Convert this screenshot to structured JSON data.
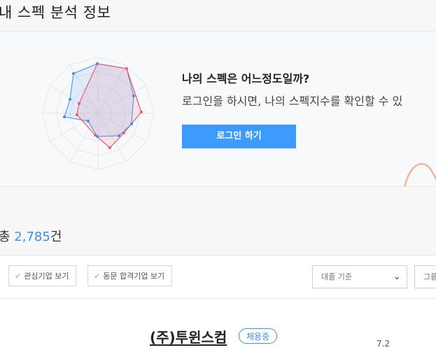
{
  "header": {
    "title": "내 스펙 분석 정보"
  },
  "promo": {
    "heading": "나의 스펙은 어느정도일까?",
    "desc": "로그인을 하시면, 나의 스펙지수를 확인할 수 있",
    "login_button": "로그인 하기",
    "colors": {
      "button": "#3d9bff",
      "series_blue": "#3d8ff0",
      "series_red": "#ef5a6f"
    }
  },
  "results": {
    "prefix": "총",
    "count": "2,785",
    "suffix": "건"
  },
  "filters": {
    "interest_label": "관심기업 보기",
    "alumni_label": "동문 합격기업 보기",
    "sort_value": "대졸 기준",
    "group_value": "그룹"
  },
  "company": {
    "name": "(주)투윈스컴",
    "status": "채용중",
    "score": "7.2"
  }
}
